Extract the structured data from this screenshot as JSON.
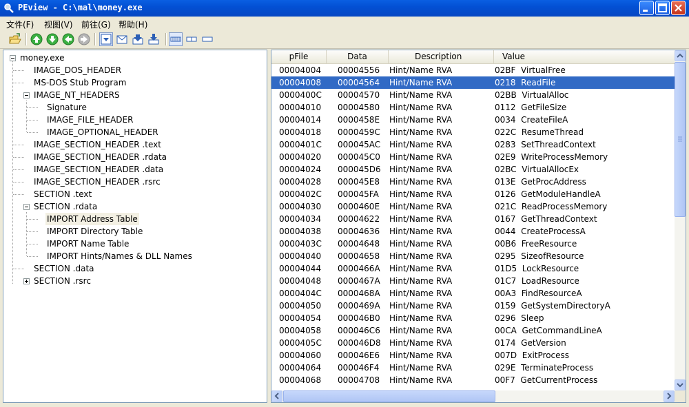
{
  "window": {
    "title": "PEview - C:\\mal\\money.exe"
  },
  "menu": [
    {
      "label": "文件(F)"
    },
    {
      "label": "视图(V)"
    },
    {
      "label": "前往(G)"
    },
    {
      "label": "帮助(H)"
    }
  ],
  "toolbar": {
    "icons": [
      "open-folder-icon",
      "go-first-icon",
      "go-next-icon",
      "go-back-icon",
      "go-forward-icon",
      "view-save-icon",
      "view-mail-icon",
      "view-down-icon",
      "view-export-icon",
      "view-bytes-icon",
      "view-words-icon",
      "view-dwords-icon"
    ]
  },
  "tree": [
    {
      "label": "money.exe",
      "level": 0,
      "expander": "minus"
    },
    {
      "label": "IMAGE_DOS_HEADER",
      "level": 1
    },
    {
      "label": "MS-DOS Stub Program",
      "level": 1
    },
    {
      "label": "IMAGE_NT_HEADERS",
      "level": 1,
      "expander": "minus"
    },
    {
      "label": "Signature",
      "level": 2
    },
    {
      "label": "IMAGE_FILE_HEADER",
      "level": 2
    },
    {
      "label": "IMAGE_OPTIONAL_HEADER",
      "level": 2
    },
    {
      "label": "IMAGE_SECTION_HEADER .text",
      "level": 1
    },
    {
      "label": "IMAGE_SECTION_HEADER .rdata",
      "level": 1
    },
    {
      "label": "IMAGE_SECTION_HEADER .data",
      "level": 1
    },
    {
      "label": "IMAGE_SECTION_HEADER .rsrc",
      "level": 1
    },
    {
      "label": "SECTION .text",
      "level": 1
    },
    {
      "label": "SECTION .rdata",
      "level": 1,
      "expander": "minus"
    },
    {
      "label": "IMPORT Address Table",
      "level": 2,
      "selected": true
    },
    {
      "label": "IMPORT Directory Table",
      "level": 2
    },
    {
      "label": "IMPORT Name Table",
      "level": 2
    },
    {
      "label": "IMPORT Hints/Names & DLL Names",
      "level": 2
    },
    {
      "label": "SECTION .data",
      "level": 1
    },
    {
      "label": "SECTION .rsrc",
      "level": 1,
      "expander": "plus"
    }
  ],
  "list": {
    "columns": [
      "pFile",
      "Data",
      "Description",
      "Value"
    ],
    "rows": [
      {
        "pfile": "00004004",
        "data": "00004556",
        "desc": "Hint/Name RVA",
        "value": "02BF  VirtualFree"
      },
      {
        "pfile": "00004008",
        "data": "00004564",
        "desc": "Hint/Name RVA",
        "value": "0218  ReadFile",
        "selected": true
      },
      {
        "pfile": "0000400C",
        "data": "00004570",
        "desc": "Hint/Name RVA",
        "value": "02BB  VirtualAlloc"
      },
      {
        "pfile": "00004010",
        "data": "00004580",
        "desc": "Hint/Name RVA",
        "value": "0112  GetFileSize"
      },
      {
        "pfile": "00004014",
        "data": "0000458E",
        "desc": "Hint/Name RVA",
        "value": "0034  CreateFileA"
      },
      {
        "pfile": "00004018",
        "data": "0000459C",
        "desc": "Hint/Name RVA",
        "value": "022C  ResumeThread"
      },
      {
        "pfile": "0000401C",
        "data": "000045AC",
        "desc": "Hint/Name RVA",
        "value": "0283  SetThreadContext"
      },
      {
        "pfile": "00004020",
        "data": "000045C0",
        "desc": "Hint/Name RVA",
        "value": "02E9  WriteProcessMemory"
      },
      {
        "pfile": "00004024",
        "data": "000045D6",
        "desc": "Hint/Name RVA",
        "value": "02BC  VirtualAllocEx"
      },
      {
        "pfile": "00004028",
        "data": "000045E8",
        "desc": "Hint/Name RVA",
        "value": "013E  GetProcAddress"
      },
      {
        "pfile": "0000402C",
        "data": "000045FA",
        "desc": "Hint/Name RVA",
        "value": "0126  GetModuleHandleA"
      },
      {
        "pfile": "00004030",
        "data": "0000460E",
        "desc": "Hint/Name RVA",
        "value": "021C  ReadProcessMemory"
      },
      {
        "pfile": "00004034",
        "data": "00004622",
        "desc": "Hint/Name RVA",
        "value": "0167  GetThreadContext"
      },
      {
        "pfile": "00004038",
        "data": "00004636",
        "desc": "Hint/Name RVA",
        "value": "0044  CreateProcessA"
      },
      {
        "pfile": "0000403C",
        "data": "00004648",
        "desc": "Hint/Name RVA",
        "value": "00B6  FreeResource"
      },
      {
        "pfile": "00004040",
        "data": "00004658",
        "desc": "Hint/Name RVA",
        "value": "0295  SizeofResource"
      },
      {
        "pfile": "00004044",
        "data": "0000466A",
        "desc": "Hint/Name RVA",
        "value": "01D5  LockResource"
      },
      {
        "pfile": "00004048",
        "data": "0000467A",
        "desc": "Hint/Name RVA",
        "value": "01C7  LoadResource"
      },
      {
        "pfile": "0000404C",
        "data": "0000468A",
        "desc": "Hint/Name RVA",
        "value": "00A3  FindResourceA"
      },
      {
        "pfile": "00004050",
        "data": "0000469A",
        "desc": "Hint/Name RVA",
        "value": "0159  GetSystemDirectoryA"
      },
      {
        "pfile": "00004054",
        "data": "000046B0",
        "desc": "Hint/Name RVA",
        "value": "0296  Sleep"
      },
      {
        "pfile": "00004058",
        "data": "000046C6",
        "desc": "Hint/Name RVA",
        "value": "00CA  GetCommandLineA"
      },
      {
        "pfile": "0000405C",
        "data": "000046D8",
        "desc": "Hint/Name RVA",
        "value": "0174  GetVersion"
      },
      {
        "pfile": "00004060",
        "data": "000046E6",
        "desc": "Hint/Name RVA",
        "value": "007D  ExitProcess"
      },
      {
        "pfile": "00004064",
        "data": "000046F4",
        "desc": "Hint/Name RVA",
        "value": "029E  TerminateProcess"
      },
      {
        "pfile": "00004068",
        "data": "00004708",
        "desc": "Hint/Name RVA",
        "value": "00F7  GetCurrentProcess"
      }
    ]
  },
  "colors": {
    "titlebar": "#0a5fe2",
    "selection": "#316ac5",
    "tree_selection": "#f3f0e3",
    "chrome": "#ece9d8"
  }
}
